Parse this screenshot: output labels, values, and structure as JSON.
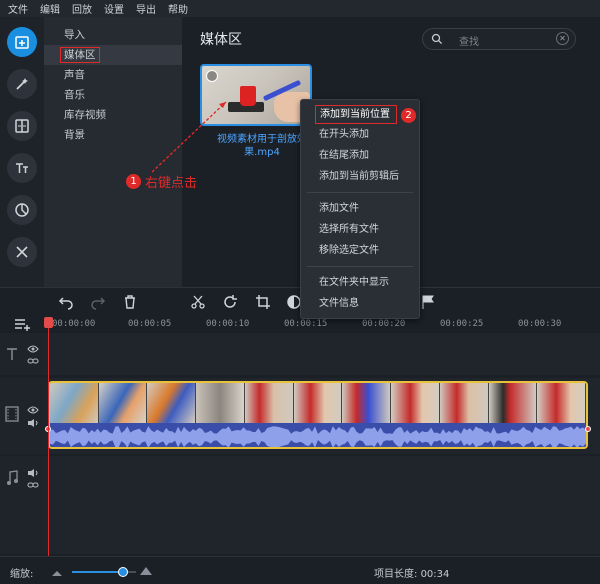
{
  "menu": [
    "文件",
    "编辑",
    "回放",
    "设置",
    "导出",
    "帮助"
  ],
  "rail": [
    {
      "icon": "import-icon",
      "active": true
    },
    {
      "icon": "magic-wand-icon",
      "active": false
    },
    {
      "icon": "transitions-icon",
      "active": false
    },
    {
      "icon": "text-icon",
      "active": false
    },
    {
      "icon": "filters-icon",
      "active": false
    },
    {
      "icon": "tools-icon",
      "active": false
    }
  ],
  "categories": [
    "导入",
    "媒体区",
    "声音",
    "音乐",
    "库存视频",
    "背景"
  ],
  "active_category": "媒体区",
  "media": {
    "title": "媒体区",
    "search_placeholder": "查找",
    "file_caption_line1": "视频素材用于剖放效",
    "file_caption_line2": "果.mp4"
  },
  "callout1": {
    "number": "1",
    "text": "右键点击"
  },
  "callout2": {
    "number": "2"
  },
  "context_menu": {
    "group1": [
      "添加到当前位置",
      "在开头添加",
      "在结尾添加",
      "添加到当前剪辑后"
    ],
    "group2": [
      "添加文件",
      "选择所有文件",
      "移除选定文件"
    ],
    "group3": [
      "在文件夹中显示",
      "文件信息"
    ]
  },
  "ruler": [
    "00:00:00",
    "00:00:05",
    "00:00:10",
    "00:00:15",
    "00:00:20",
    "00:00:25",
    "00:00:30"
  ],
  "bottom": {
    "zoom_label": "缩放:",
    "zoom_level": 0.8,
    "project_length_label": "项目长度:",
    "project_length": "00:34"
  },
  "colors": {
    "accent": "#2a8fe3",
    "highlight": "#e02a2a",
    "clip_border": "#e9c23b"
  }
}
